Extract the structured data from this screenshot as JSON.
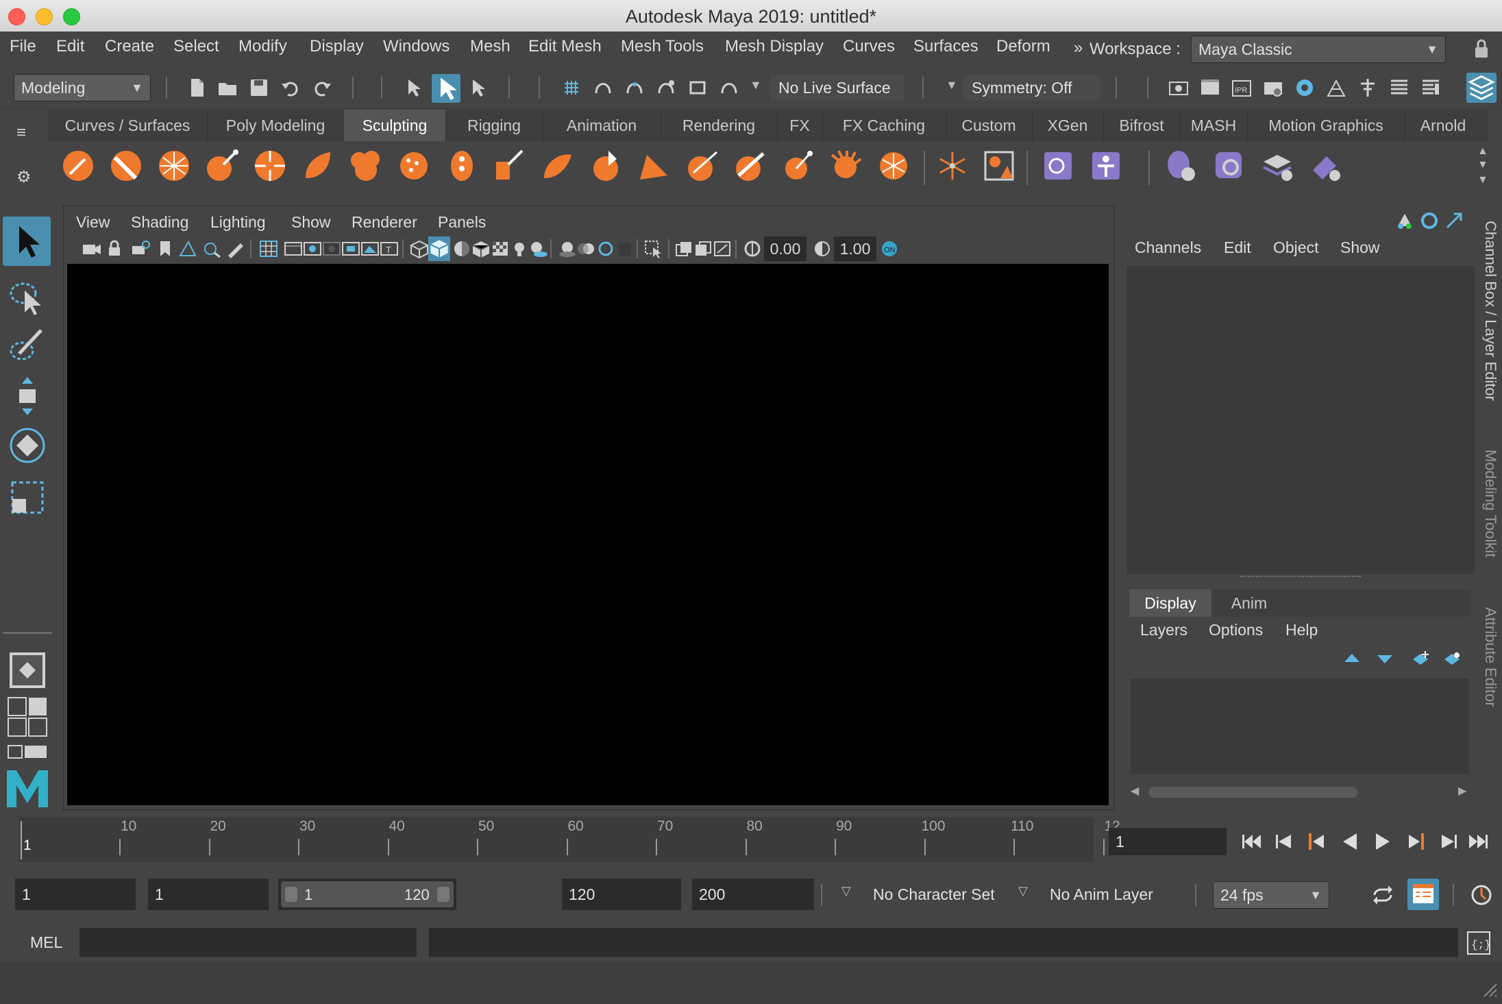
{
  "window": {
    "title": "Autodesk Maya 2019: untitled*"
  },
  "menubar": {
    "items": [
      "File",
      "Edit",
      "Create",
      "Select",
      "Modify",
      "Display",
      "Windows",
      "Mesh",
      "Edit Mesh",
      "Mesh Tools",
      "Mesh Display",
      "Curves",
      "Surfaces",
      "Deform"
    ],
    "overflow": "»",
    "workspace_label": "Workspace :",
    "workspace_value": "Maya Classic"
  },
  "statusline": {
    "menuset": "Modeling",
    "live_surface": "No Live Surface",
    "symmetry": "Symmetry: Off"
  },
  "shelf": {
    "tabs": [
      "Curves / Surfaces",
      "Poly Modeling",
      "Sculpting",
      "Rigging",
      "Animation",
      "Rendering",
      "FX",
      "FX Caching",
      "Custom",
      "XGen",
      "Bifrost",
      "MASH",
      "Motion Graphics",
      "Arnold"
    ],
    "active_tab": "Sculpting"
  },
  "viewport": {
    "menus": [
      "View",
      "Shading",
      "Lighting",
      "Show",
      "Renderer",
      "Panels"
    ],
    "exposure": "0.00",
    "gamma": "1.00"
  },
  "channelbox": {
    "menus": [
      "Channels",
      "Edit",
      "Object",
      "Show"
    ],
    "layer_tabs": [
      "Display",
      "Anim"
    ],
    "layer_menus": [
      "Layers",
      "Options",
      "Help"
    ]
  },
  "side_tabs": [
    "Channel Box / Layer Editor",
    "Modeling Toolkit",
    "Attribute Editor"
  ],
  "timeline": {
    "ticks": [
      "10",
      "20",
      "30",
      "40",
      "50",
      "60",
      "70",
      "80",
      "90",
      "100",
      "110",
      "12"
    ],
    "start_marker": "1",
    "current_frame": "1"
  },
  "range": {
    "start": "1",
    "playback_start": "1",
    "slider_start": "1",
    "slider_end": "120",
    "playback_end": "120",
    "end": "200",
    "character_set": "No Character Set",
    "anim_layer": "No Anim Layer",
    "fps": "24 fps"
  },
  "cmdline": {
    "label": "MEL"
  },
  "colors": {
    "accent": "#5fb7e0",
    "shelf_icon": "#ef7a2e",
    "maya_logo": "#32b0c8"
  }
}
